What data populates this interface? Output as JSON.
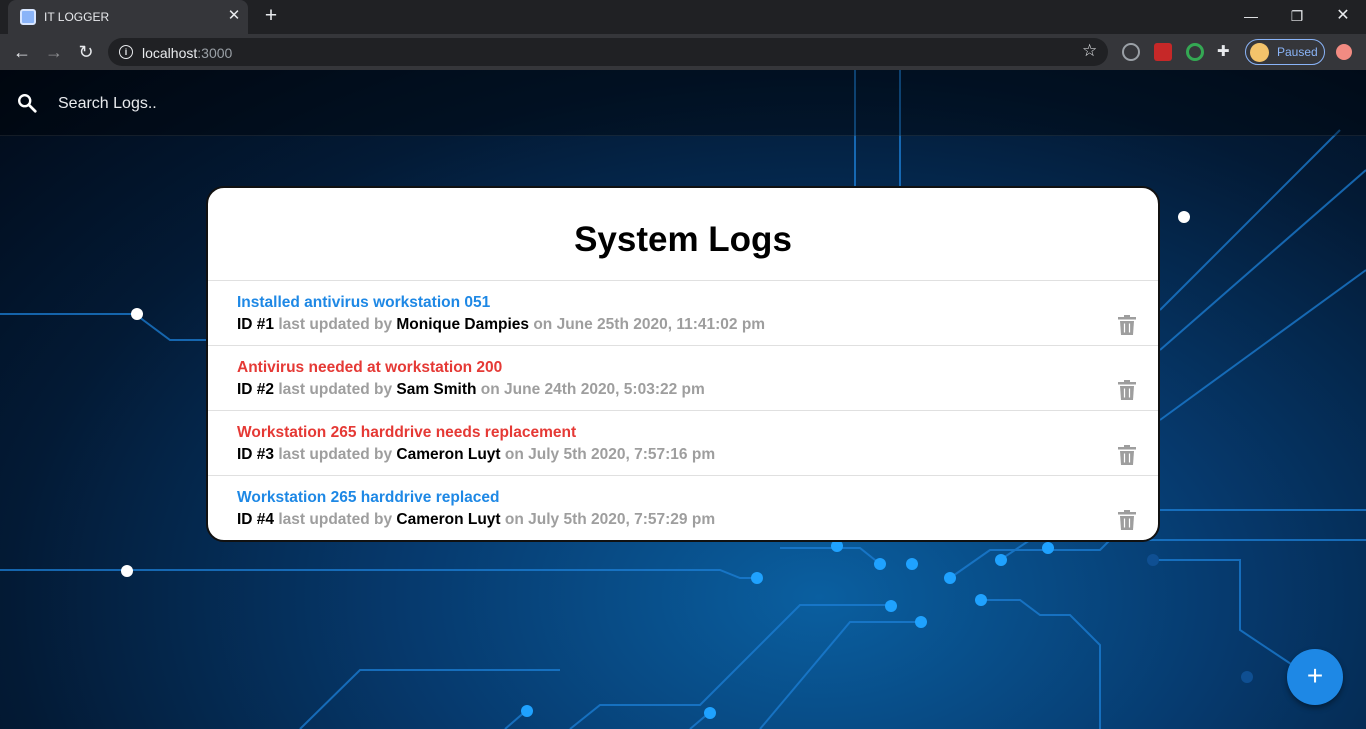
{
  "browser": {
    "tab_title": "IT LOGGER",
    "tab_close": "✕",
    "new_tab": "+",
    "window_controls": {
      "minimize": "—",
      "maximize": "❐",
      "close": "✕"
    },
    "nav": {
      "back": "←",
      "forward": "→",
      "reload": "↻"
    },
    "url_host": "localhost",
    "url_port": ":3000",
    "bookmark_icon": "☆",
    "profile_label": "Paused",
    "extensions_icon": "puzzle-icon"
  },
  "search": {
    "placeholder": "Search Logs.."
  },
  "logs_title": "System Logs",
  "logs": [
    {
      "message": "Installed antivirus workstation 051",
      "attention": false,
      "id_label": "ID #1",
      "updated_by_label": "last updated by",
      "tech": "Monique Dampies",
      "date": "on June 25th 2020, 11:41:02 pm"
    },
    {
      "message": "Antivirus needed at workstation 200",
      "attention": true,
      "id_label": "ID #2",
      "updated_by_label": "last updated by",
      "tech": "Sam Smith",
      "date": "on June 24th 2020, 5:03:22 pm"
    },
    {
      "message": "Workstation 265 harddrive needs replacement",
      "attention": true,
      "id_label": "ID #3",
      "updated_by_label": "last updated by",
      "tech": "Cameron Luyt",
      "date": "on July 5th 2020, 7:57:16 pm"
    },
    {
      "message": "Workstation 265 harddrive replaced",
      "attention": false,
      "id_label": "ID #4",
      "updated_by_label": "last updated by",
      "tech": "Cameron Luyt",
      "date": "on July 5th 2020, 7:57:29 pm"
    }
  ],
  "fab_label": "+",
  "colors": {
    "normal_message": "#1e88e5",
    "attention_message": "#e53935",
    "meta_text": "#9e9e9e",
    "fab": "#1e88e5"
  }
}
